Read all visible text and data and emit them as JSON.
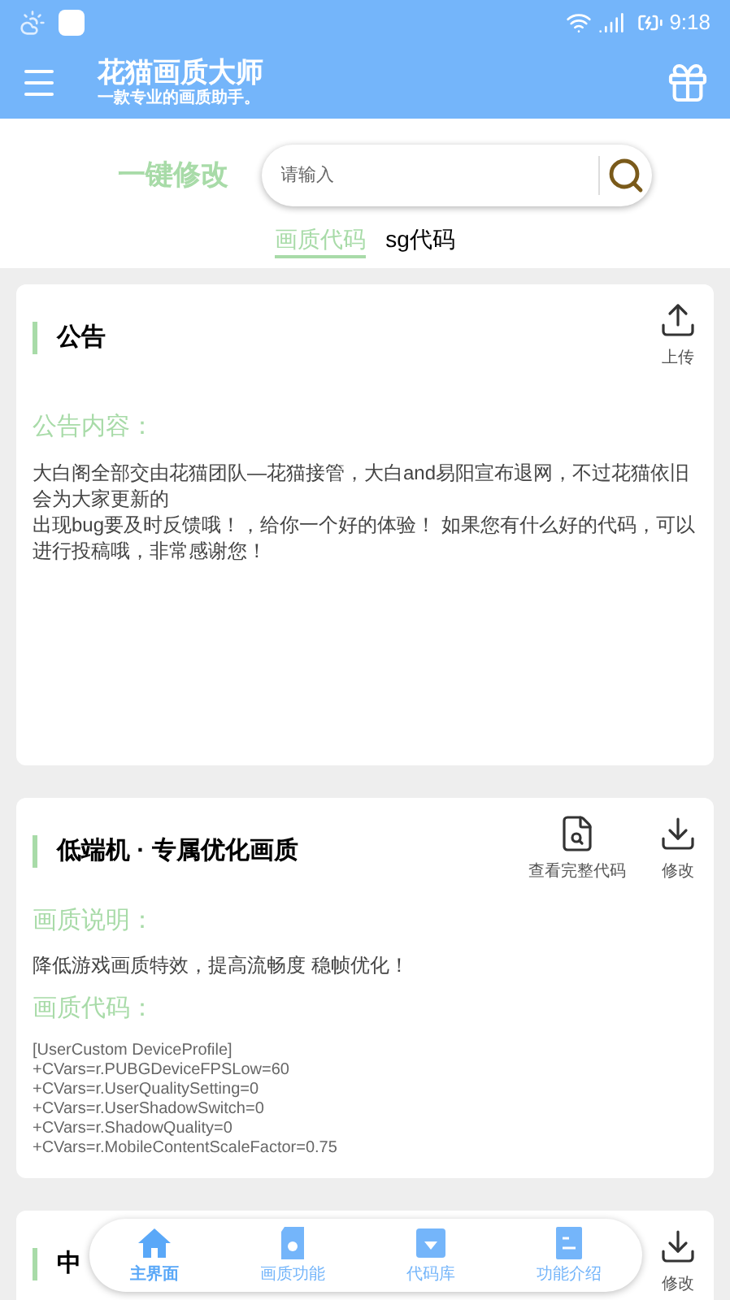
{
  "status_bar": {
    "time": "9:18"
  },
  "app_bar": {
    "title": "花猫画质大师",
    "subtitle": "一款专业的画质助手。"
  },
  "search": {
    "label": "一键修改",
    "placeholder": "请输入"
  },
  "tabs": [
    {
      "label": "画质代码",
      "selected": true
    },
    {
      "label": "sg代码",
      "selected": false
    }
  ],
  "cards": [
    {
      "title": "公告",
      "actions": [
        {
          "kind": "upload",
          "label": "上传"
        }
      ],
      "sections": [
        {
          "kind": "notice",
          "heading": "公告内容：",
          "lines": [
            "大白阁全部交由花猫团队—花猫接管，大白and易阳宣布退网，不过花猫依旧会为大家更新的",
            "出现bug要及时反馈哦！，给你一个好的体验！ 如果您有什么好的代码，可以进行投稿哦，非常感谢您！"
          ]
        }
      ]
    },
    {
      "title": "低端机 · 专属优化画质",
      "actions": [
        {
          "kind": "view",
          "label": "查看完整代码"
        },
        {
          "kind": "download",
          "label": "修改"
        }
      ],
      "sections": [
        {
          "kind": "text",
          "heading": "画质说明：",
          "lines": [
            "降低游戏画质特效，提高流畅度 稳帧优化！"
          ]
        },
        {
          "kind": "code",
          "heading": "画质代码：",
          "lines": [
            "[UserCustom DeviceProfile]",
            "+CVars=r.PUBGDeviceFPSLow=60",
            "+CVars=r.UserQualitySetting=0",
            "+CVars=r.UserShadowSwitch=0",
            "+CVars=r.ShadowQuality=0",
            "+CVars=r.MobileContentScaleFactor=0.75"
          ]
        }
      ]
    },
    {
      "title": "中",
      "actions": [
        {
          "kind": "download",
          "label": "修改"
        }
      ]
    }
  ],
  "bottom_nav": [
    {
      "kind": "home",
      "label": "主界面",
      "selected": true
    },
    {
      "kind": "card",
      "label": "画质功能",
      "selected": false
    },
    {
      "kind": "box",
      "label": "代码库",
      "selected": false
    },
    {
      "kind": "doc",
      "label": "功能介绍",
      "selected": false
    }
  ]
}
